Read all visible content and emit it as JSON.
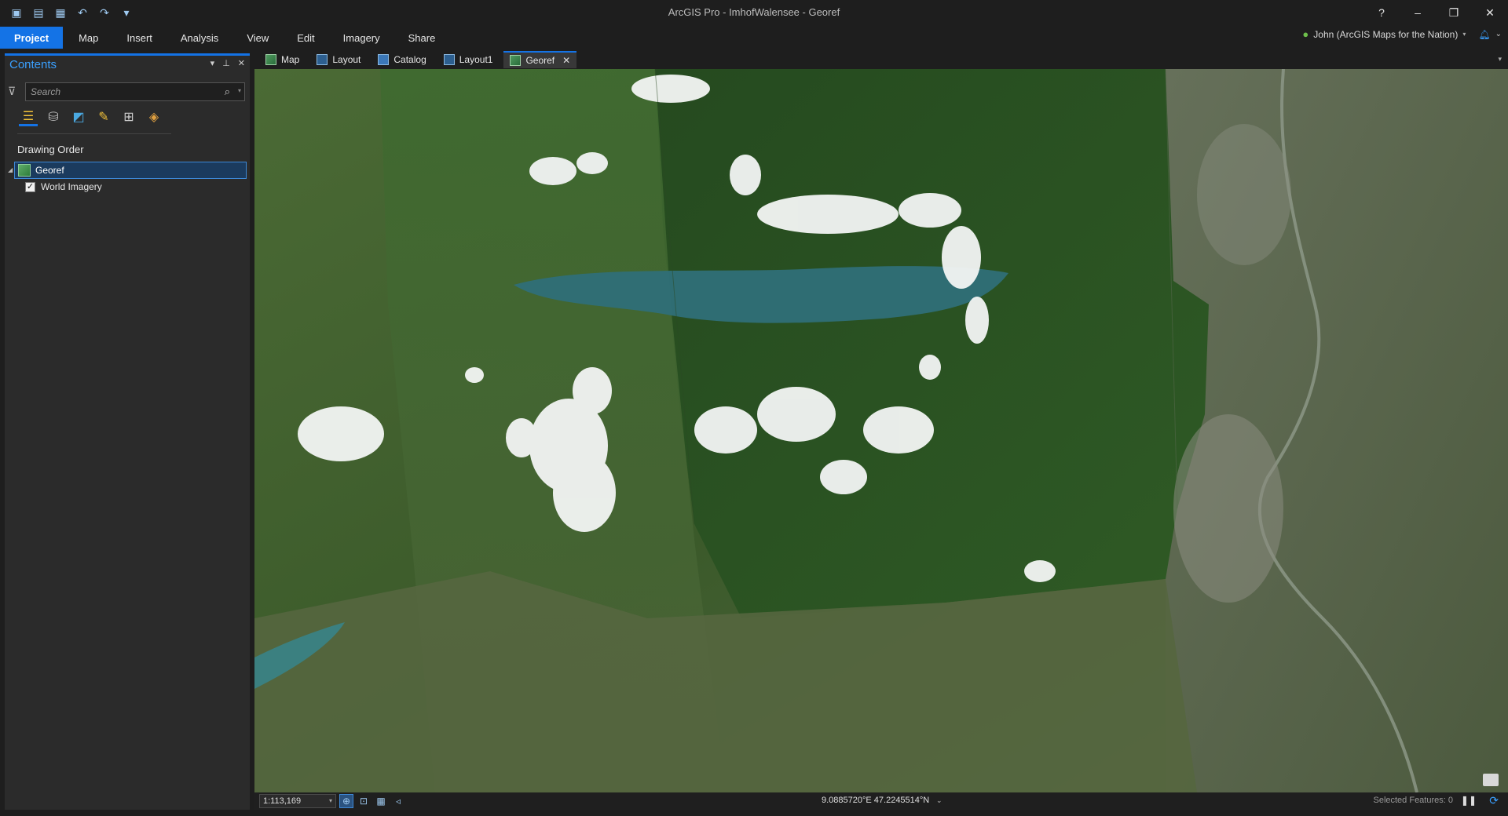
{
  "window": {
    "title": "ArcGIS Pro - ImhofWalensee - Georef",
    "help_label": "?",
    "minimize_label": "–",
    "restore_label": "❐",
    "close_label": "✕"
  },
  "quick_access": [
    {
      "name": "new-project-icon",
      "glyph": "▣"
    },
    {
      "name": "open-project-icon",
      "glyph": "▤"
    },
    {
      "name": "save-project-icon",
      "glyph": "▦"
    },
    {
      "name": "undo-icon",
      "glyph": "↶"
    },
    {
      "name": "redo-icon",
      "glyph": "↷"
    },
    {
      "name": "customize-qat-icon",
      "glyph": "▾"
    }
  ],
  "ribbon": {
    "tabs": [
      "Project",
      "Map",
      "Insert",
      "Analysis",
      "View",
      "Edit",
      "Imagery",
      "Share"
    ],
    "active_tab": "Project"
  },
  "user": {
    "label": "John (ArcGIS Maps for the Nation)"
  },
  "contents": {
    "title": "Contents",
    "search_placeholder": "Search",
    "section_title": "Drawing Order",
    "layers": [
      {
        "label": "Georef",
        "selected": true
      },
      {
        "label": "World Imagery",
        "checked": true
      }
    ]
  },
  "doc_tabs": [
    {
      "label": "Map",
      "kind": "map"
    },
    {
      "label": "Layout",
      "kind": "layout"
    },
    {
      "label": "Catalog",
      "kind": "catalog"
    },
    {
      "label": "Layout1",
      "kind": "layout"
    },
    {
      "label": "Georef",
      "kind": "map",
      "active": true
    }
  ],
  "status": {
    "scale": "1:113,169",
    "coordinates": "9.0885720°E 47.2245514°N",
    "selected_features": "Selected Features: 0"
  },
  "colors": {
    "accent": "#1473e6",
    "accent_text": "#3aa0ff",
    "panel_bg": "#2b2b2b",
    "app_bg": "#1e1e1e"
  }
}
